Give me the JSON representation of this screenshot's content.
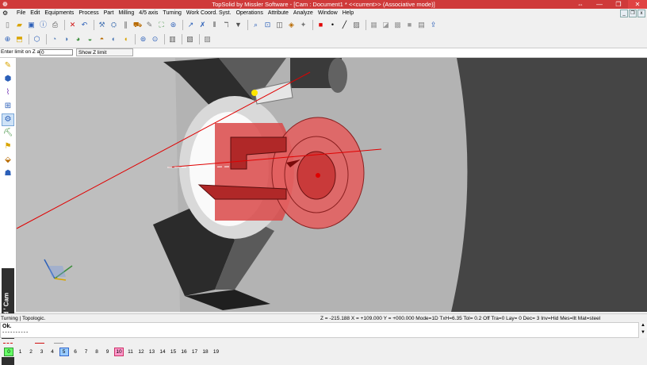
{
  "window": {
    "title": "TopSolid by Missler Software - [Cam : Document1 *  <<current>> (Associative mode)]",
    "controls": [
      "⇔",
      "—",
      "❐",
      "✕"
    ]
  },
  "menu": [
    "File",
    "Edit",
    "Equipments",
    "Process",
    "Part",
    "Milling",
    "4/5 axis",
    "Turning",
    "Work Coord. Syst.",
    "Operations",
    "Attribute",
    "Analyze",
    "Window",
    "Help"
  ],
  "mdi_controls": [
    "_",
    "❐",
    "x"
  ],
  "prompt": {
    "label": "Enter limit on Z axis=",
    "value": "0",
    "button": "Show Z limit"
  },
  "brand": "TopSolid ' Cam",
  "status": {
    "left": "Turning | Topologic.",
    "right": "Z = -215.188  X = +109.000  Y = +000.000  Mode=1D   TxH=6.35    Tol=   0.2    Off  Tra=0    Lay=  0    Dec= 3    Inv=Hid   Mes=llt   Mat=steel"
  },
  "output": {
    "line1": "Ok.",
    "line2": "----------"
  },
  "layers": [
    "0",
    "1",
    "2",
    "3",
    "4",
    "5",
    "6",
    "7",
    "8",
    "9",
    "10",
    "11",
    "12",
    "13",
    "14",
    "15",
    "16",
    "17",
    "18",
    "19"
  ],
  "colors": {
    "titlebar": "#cf3a3a",
    "viewport_bg": "#bebebe",
    "workpiece": "#d94848",
    "axis_line": "#e00000"
  }
}
